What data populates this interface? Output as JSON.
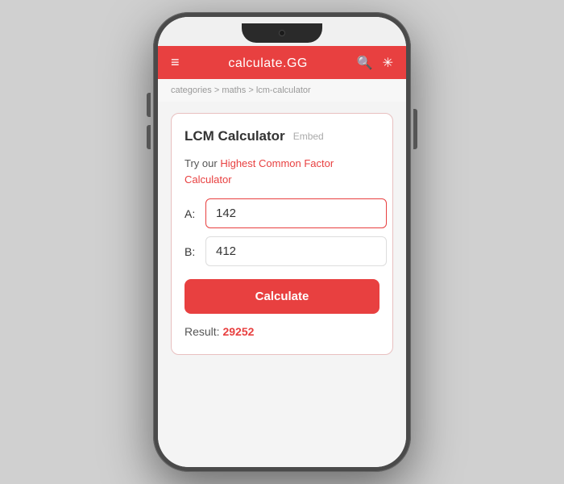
{
  "header": {
    "logo_main": "calculate.",
    "logo_accent": "GG",
    "menu_icon": "≡",
    "search_icon": "🔍",
    "theme_icon": "✳"
  },
  "breadcrumb": {
    "part1": "categories",
    "separator1": " > ",
    "part2": "maths",
    "separator2": " > ",
    "part3": "lcm-calculator"
  },
  "calculator": {
    "title": "LCM Calculator",
    "embed_label": "Embed",
    "hcf_text_before": "Try our ",
    "hcf_link": "Highest Common Factor Calculator",
    "label_a": "A:",
    "label_b": "B:",
    "input_a_value": "142",
    "input_b_value": "412",
    "input_a_placeholder": "",
    "input_b_placeholder": "",
    "calculate_label": "Calculate",
    "result_label": "Result: ",
    "result_value": "29252"
  }
}
